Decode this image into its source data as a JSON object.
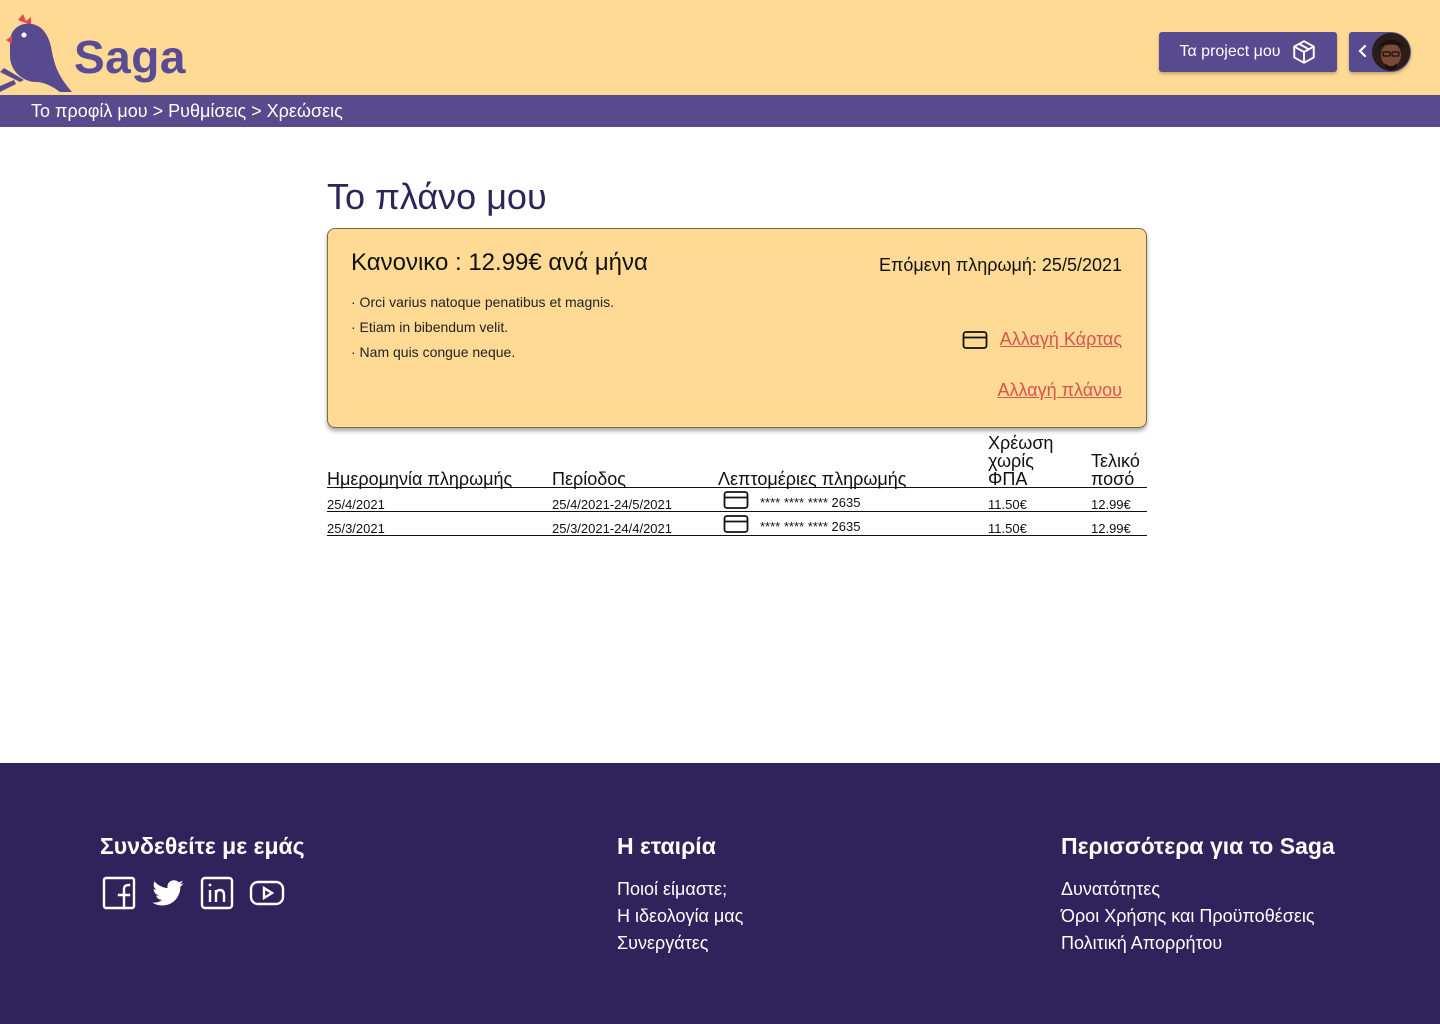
{
  "header": {
    "logo_text": "Saga",
    "projects_button": "Τα project μου"
  },
  "breadcrumb": "Το προφίλ μου > Ρυθμίσεις > Χρεώσεις",
  "main": {
    "title": "Το πλάνο μου",
    "plan": {
      "name": "Κανονικο : 12.99€ ανά μήνα",
      "next_payment": "Επόμενη πληρωμή: 25/5/2021",
      "features": [
        "· Orci varius natoque penatibus et magnis.",
        "· Etiam in bibendum velit.",
        "· Nam quis congue neque."
      ],
      "change_card": "Αλλαγή Κάρτας",
      "change_plan": "Αλλαγή πλάνου"
    },
    "table": {
      "headers": {
        "date": "Ημερομηνία πληρωμής",
        "period": "Περίοδος",
        "details": "Λεπτομέριες πληρωμής",
        "net_line1": "Χρέωση",
        "net_line2": "χωρίς",
        "net_line3": "ΦΠΑ",
        "total_line1": "Τελικό",
        "total_line2": "ποσό"
      },
      "rows": [
        {
          "date": "25/4/2021",
          "period": "25/4/2021-24/5/2021",
          "card": "**** **** **** 2635",
          "net": "11.50€",
          "total": "12.99€"
        },
        {
          "date": "25/3/2021",
          "period": "25/3/2021-24/4/2021",
          "card": "**** **** **** 2635",
          "net": "11.50€",
          "total": "12.99€"
        }
      ]
    }
  },
  "footer": {
    "connect_title": "Συνδεθείτε με εμάς",
    "company_title": "Η εταιρία",
    "company_links": [
      "Ποιοί είμαστε;",
      "Η ιδεολογία μας",
      "Συνεργάτες"
    ],
    "more_title": "Περισσότερα για το Saga",
    "more_links": [
      "Δυνατότητες",
      "Όροι Χρήσης και Προϋποθέσεις",
      "Πολιτική Απορρήτου"
    ]
  },
  "colors": {
    "header_bg": "#FFDA94",
    "brand_purple": "#574A8F",
    "footer_bg": "#30235C",
    "link_red": "#D9534F"
  },
  "icons": [
    "saga-bird-logo",
    "box-icon",
    "chevron-left-icon",
    "avatar",
    "credit-card-icon",
    "facebook-icon",
    "twitter-icon",
    "linkedin-icon",
    "youtube-icon"
  ]
}
